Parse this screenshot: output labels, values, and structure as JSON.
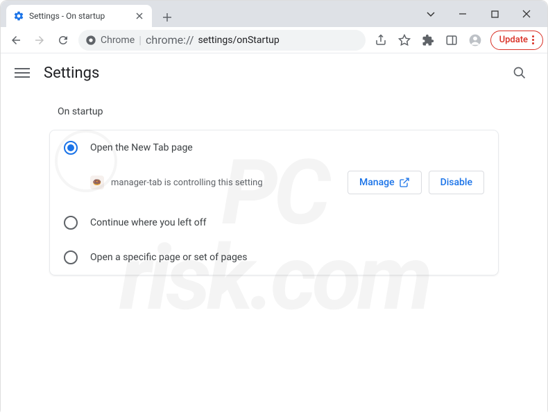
{
  "window": {
    "tab_title": "Settings - On startup"
  },
  "toolbar": {
    "omnibox_label": "Chrome",
    "omnibox_host": "chrome://",
    "omnibox_path": "settings/onStartup",
    "update_label": "Update"
  },
  "settings": {
    "title": "Settings",
    "section": "On startup",
    "options": [
      {
        "label": "Open the New Tab page",
        "selected": true
      },
      {
        "label": "Continue where you left off",
        "selected": false
      },
      {
        "label": "Open a specific page or set of pages",
        "selected": false
      }
    ],
    "extension": {
      "name": "manager-tab",
      "notice": "manager-tab is controlling this setting",
      "manage_label": "Manage",
      "disable_label": "Disable"
    }
  },
  "watermark": {
    "line1": "PC",
    "line2": "risk.com"
  }
}
